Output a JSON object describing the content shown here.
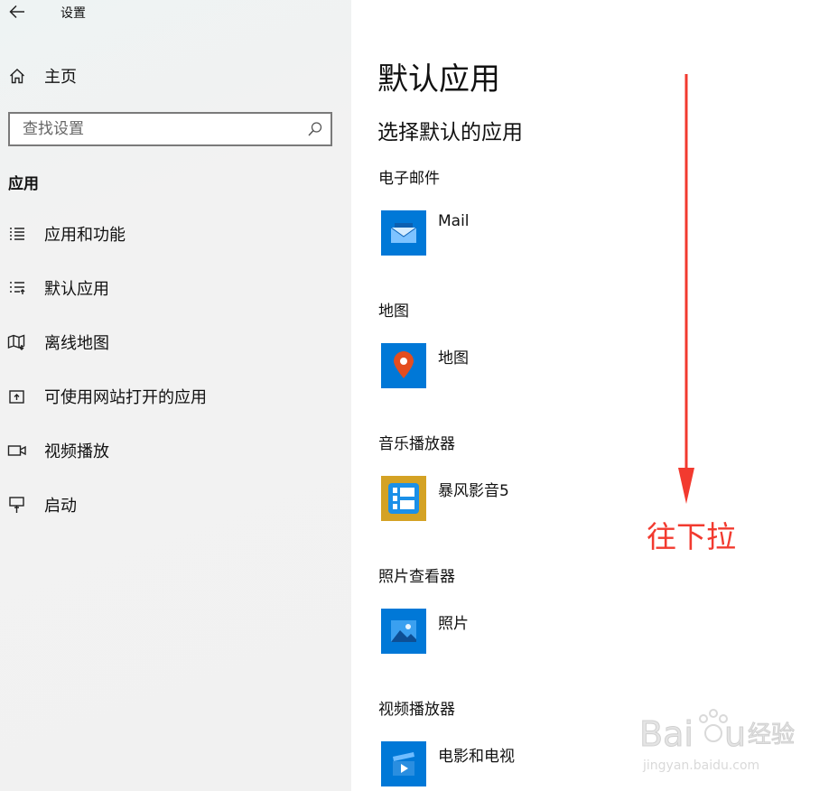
{
  "window": {
    "title": "设置"
  },
  "sidebar": {
    "home_label": "主页",
    "search_placeholder": "查找设置",
    "section_title": "应用",
    "items": [
      {
        "label": "应用和功能",
        "icon": "apps-features-icon"
      },
      {
        "label": "默认应用",
        "icon": "default-apps-icon"
      },
      {
        "label": "离线地图",
        "icon": "offline-maps-icon"
      },
      {
        "label": "可使用网站打开的应用",
        "icon": "apps-for-websites-icon"
      },
      {
        "label": "视频播放",
        "icon": "video-playback-icon"
      },
      {
        "label": "启动",
        "icon": "startup-icon"
      }
    ]
  },
  "main": {
    "title": "默认应用",
    "subtitle": "选择默认的应用",
    "categories": [
      {
        "label": "电子邮件",
        "app": "Mail",
        "icon": "mail-icon",
        "tile_color": "#0078d7"
      },
      {
        "label": "地图",
        "app": "地图",
        "icon": "maps-pin-icon",
        "tile_color": "#0078d7"
      },
      {
        "label": "音乐播放器",
        "app": "暴风影音5",
        "icon": "baofeng-player-icon",
        "tile_color": "#d4a224"
      },
      {
        "label": "照片查看器",
        "app": "照片",
        "icon": "photos-icon",
        "tile_color": "#0078d7"
      },
      {
        "label": "视频播放器",
        "app": "电影和电视",
        "icon": "movies-tv-icon",
        "tile_color": "#0078d7"
      }
    ]
  },
  "annotation": {
    "text": "往下拉",
    "color": "#f23a2f"
  },
  "watermark": {
    "brand_text": "Baidu经验",
    "url_text": "jingyan.baidu.com"
  }
}
